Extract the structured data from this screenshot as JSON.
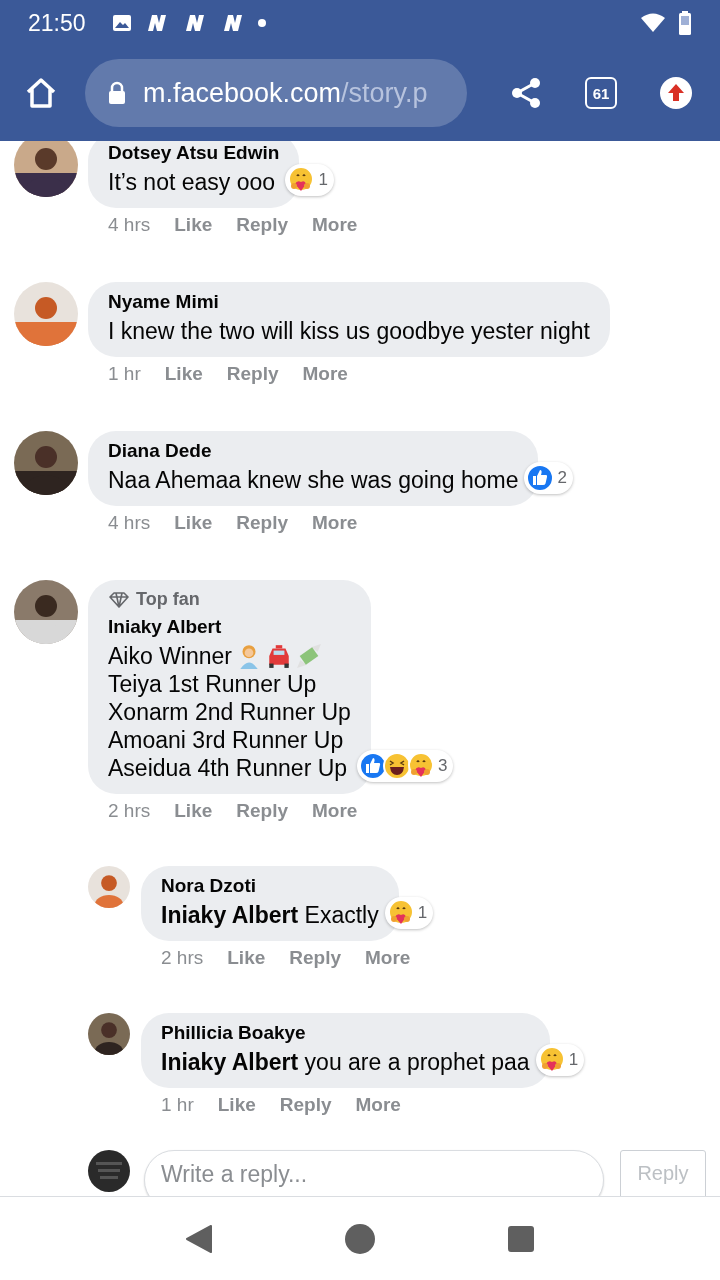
{
  "status_bar": {
    "time": "21:50"
  },
  "browser": {
    "url_host": "m.facebook.com",
    "url_path": "/story.p",
    "tab_count": "61"
  },
  "comments": [
    {
      "name": "Dotsey Atsu Edwin",
      "lines": [
        {
          "text": "It’s not easy ooo"
        }
      ],
      "reactions": [
        {
          "kind": "care"
        }
      ],
      "reaction_count": "1",
      "time": "4 hrs",
      "actions": [
        "Like",
        "Reply",
        "More"
      ]
    },
    {
      "name": "Nyame Mimi",
      "lines": [
        {
          "text": "I knew the two will kiss us goodbye yester night"
        }
      ],
      "time": "1 hr",
      "actions": [
        "Like",
        "Reply",
        "More"
      ]
    },
    {
      "name": "Diana Dede",
      "lines": [
        {
          "text": "Naa Ahemaa knew she was going home"
        }
      ],
      "reactions": [
        {
          "kind": "like"
        }
      ],
      "reaction_count": "2",
      "time": "4 hrs",
      "actions": [
        "Like",
        "Reply",
        "More"
      ]
    },
    {
      "badge": "Top fan",
      "name": "Iniaky Albert",
      "lines": [
        {
          "text": "Aiko Winner",
          "emoji": [
            {
              "kind": "person"
            },
            {
              "kind": "car"
            },
            {
              "kind": "money"
            }
          ]
        },
        {
          "text": "Teiya 1st Runner Up"
        },
        {
          "text": "Xonarm 2nd Runner Up"
        },
        {
          "text": "Amoani 3rd Runner Up"
        },
        {
          "text": "Aseidua 4th Runner Up"
        }
      ],
      "reactions": [
        {
          "kind": "like"
        },
        {
          "kind": "laugh"
        },
        {
          "kind": "care"
        }
      ],
      "reaction_count": "3",
      "time": "2 hrs",
      "actions": [
        "Like",
        "Reply",
        "More"
      ],
      "children": [
        {
          "name": "Nora Dzoti",
          "lines": [
            {
              "text": "**Iniaky Albert** Exactly"
            }
          ],
          "reactions": [
            {
              "kind": "care"
            }
          ],
          "reaction_count": "1",
          "time": "2 hrs",
          "actions": [
            "Like",
            "Reply",
            "More"
          ]
        },
        {
          "name": "Phillicia Boakye",
          "lines": [
            {
              "text": "**Iniaky Albert** you are a prophet paa"
            }
          ],
          "reactions": [
            {
              "kind": "care"
            }
          ],
          "reaction_count": "1",
          "time": "1 hr",
          "actions": [
            "Like",
            "Reply",
            "More"
          ]
        }
      ]
    }
  ],
  "reply_box": {
    "placeholder": "Write a reply...",
    "button": "Reply"
  }
}
